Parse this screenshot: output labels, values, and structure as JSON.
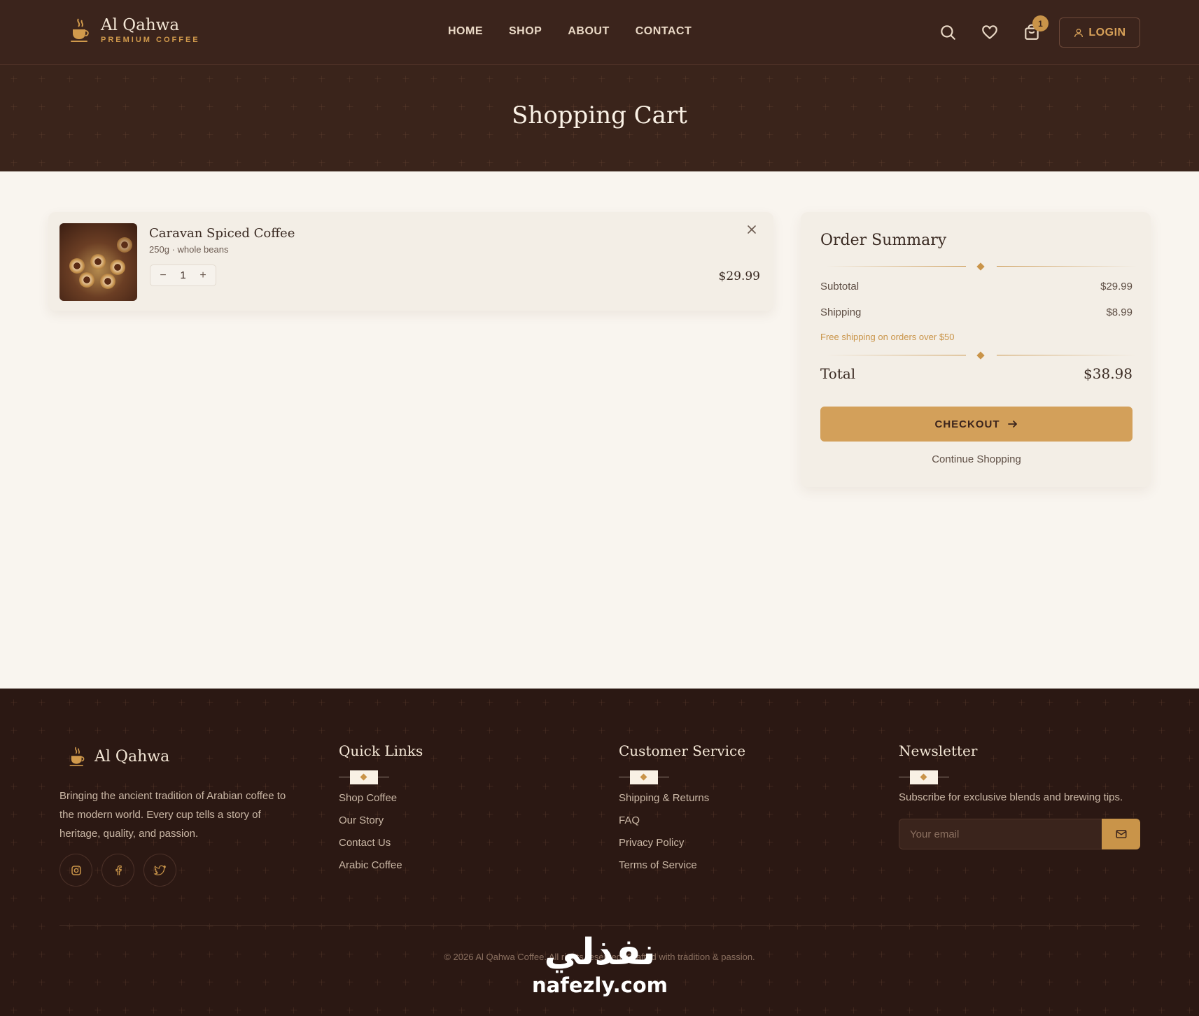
{
  "brand": {
    "name": "Al Qahwa",
    "tagline": "PREMIUM COFFEE"
  },
  "nav": {
    "items": [
      "HOME",
      "SHOP",
      "ABOUT",
      "CONTACT"
    ]
  },
  "header": {
    "cart_count": "1",
    "login_label": "LOGIN"
  },
  "hero": {
    "title": "Shopping Cart"
  },
  "cart": {
    "items": [
      {
        "name": "Caravan Spiced Coffee",
        "variant": "250g · whole beans",
        "quantity": "1",
        "price": "$29.99",
        "minus_symbol": "−",
        "plus_symbol": "+"
      }
    ]
  },
  "summary": {
    "title": "Order Summary",
    "subtotal_label": "Subtotal",
    "subtotal_value": "$29.99",
    "shipping_label": "Shipping",
    "shipping_value": "$8.99",
    "shipping_note": "Free shipping on orders over $50",
    "total_label": "Total",
    "total_value": "$38.98",
    "checkout_label": "CHECKOUT",
    "continue_label": "Continue Shopping"
  },
  "footer": {
    "brand_name": "Al Qahwa",
    "about": "Bringing the ancient tradition of Arabian coffee to the modern world. Every cup tells a story of heritage, quality, and passion.",
    "quick_links": {
      "title": "Quick Links",
      "items": [
        "Shop Coffee",
        "Our Story",
        "Contact Us",
        "Arabic Coffee"
      ]
    },
    "customer_service": {
      "title": "Customer Service",
      "items": [
        "Shipping & Returns",
        "FAQ",
        "Privacy Policy",
        "Terms of Service"
      ]
    },
    "newsletter": {
      "title": "Newsletter",
      "text": "Subscribe for exclusive blends and brewing tips.",
      "placeholder": "Your email"
    },
    "copyright": "© 2026 Al Qahwa Coffee. All rights reserved. Crafted with tradition & passion.",
    "social": [
      "instagram-icon",
      "facebook-icon",
      "twitter-icon"
    ]
  },
  "watermark": {
    "arabic": "نفذلي",
    "latin": "nafezly.com"
  },
  "colors": {
    "header_bg": "#3b241c",
    "hero_bg": "#2d1a14",
    "accent": "#d3a05a",
    "page_bg": "#f9f5ef",
    "footer_bg": "#2b1813"
  }
}
